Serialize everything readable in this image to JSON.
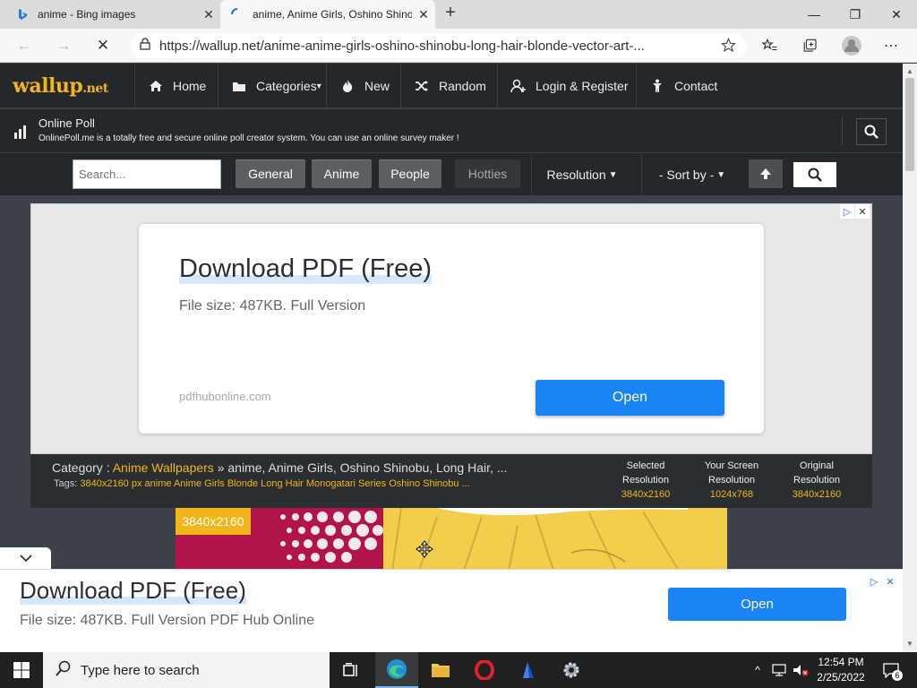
{
  "browser": {
    "tabs": [
      {
        "title": "anime - Bing images",
        "active": false
      },
      {
        "title": "anime, Anime Girls, Oshino Shinobu",
        "active": true
      }
    ],
    "url": "https://wallup.net/anime-anime-girls-oshino-shinobu-long-hair-blonde-vector-art-..."
  },
  "site": {
    "logo_main": "wallup",
    "logo_suffix": ".net",
    "nav": [
      {
        "label": "Home",
        "icon": "home-icon"
      },
      {
        "label": "Categories",
        "icon": "folder-icon",
        "caret": "▾"
      },
      {
        "label": "New",
        "icon": "fire-icon"
      },
      {
        "label": "Random",
        "icon": "shuffle-icon"
      },
      {
        "label": "Login & Register",
        "icon": "user-plus-icon"
      },
      {
        "label": "Contact",
        "icon": "person-icon"
      }
    ],
    "poll": {
      "title": "Online Poll",
      "description": "OnlinePoll.me is a totally free and secure online poll creator system. You can use an online survey maker !"
    },
    "filter": {
      "search_placeholder": "Search...",
      "buttons": [
        "General",
        "Anime",
        "People",
        "Hotties"
      ],
      "resolution": "Resolution",
      "sort": "- Sort by -"
    }
  },
  "ad_top": {
    "headline": "Download PDF (Free)",
    "subline": "File size: 487KB. Full Version",
    "domain": "pdfhubonline.com",
    "button": "Open"
  },
  "category": {
    "label": "Category :",
    "link": "Anime Wallpapers",
    "rest": "» anime, Anime Girls, Oshino Shinobu, Long Hair, ...",
    "tags_label": "Tags:",
    "tags": "3840x2160 px anime Anime Girls Blonde Long Hair Monogatari Series Oshino Shinobu ...",
    "resolutions": [
      {
        "label1": "Selected",
        "label2": "Resolution",
        "value": "3840x2160"
      },
      {
        "label1": "Your Screen",
        "label2": "Resolution",
        "value": "1024x768"
      },
      {
        "label1": "Original",
        "label2": "Resolution",
        "value": "3840x2160"
      }
    ]
  },
  "preview_badge": "3840x2160",
  "ad_bottom": {
    "headline": "Download PDF (Free)",
    "subline": "File size: 487KB. Full Version PDF Hub Online",
    "button": "Open"
  },
  "taskbar": {
    "search_placeholder": "Type here to search",
    "time": "12:54 PM",
    "date": "2/25/2022",
    "notifications": "6"
  },
  "colors": {
    "accent": "#f2b51c",
    "ad_button": "#1a84f5",
    "nav_bg": "#25282b"
  }
}
